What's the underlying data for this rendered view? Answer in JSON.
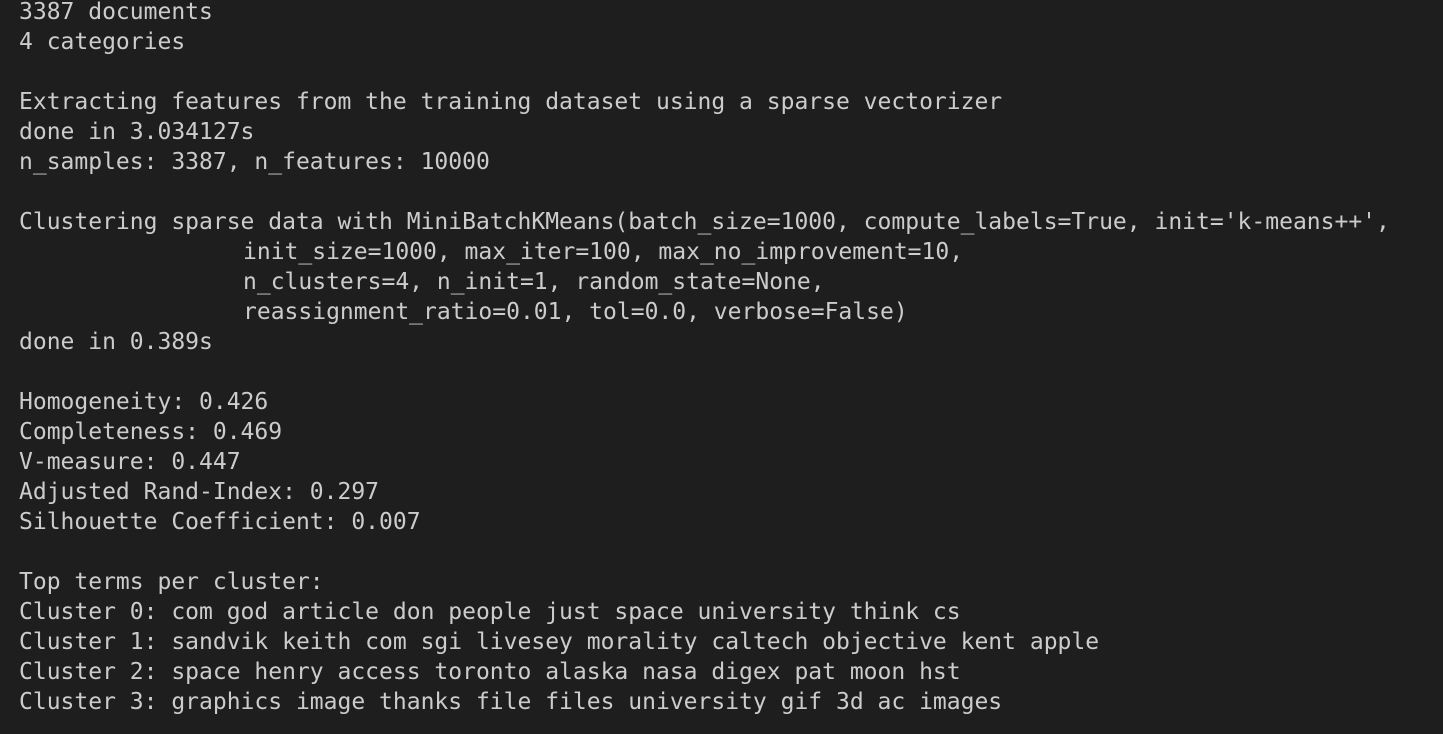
{
  "output": {
    "lines": [
      "3387 documents",
      "4 categories",
      "",
      "Extracting features from the training dataset using a sparse vectorizer",
      "done in 3.034127s",
      "n_samples: 3387, n_features: 10000",
      "",
      "Clustering sparse data with MiniBatchKMeans(batch_size=1000, compute_labels=True, init='k-means++',",
      "init_size=1000, max_iter=100, max_no_improvement=10,",
      "n_clusters=4, n_init=1, random_state=None,",
      "reassignment_ratio=0.01, tol=0.0, verbose=False)",
      "done in 0.389s",
      "",
      "Homogeneity: 0.426",
      "Completeness: 0.469",
      "V-measure: 0.447",
      "Adjusted Rand-Index: 0.297",
      "Silhouette Coefficient: 0.007",
      "",
      "Top terms per cluster:",
      "Cluster 0: com god article don people just space university think cs",
      "Cluster 1: sandvik keith com sgi livesey morality caltech objective kent apple",
      "Cluster 2: space henry access toronto alaska nasa digex pat moon hst",
      "Cluster 3: graphics image thanks file files university gif 3d ac images"
    ]
  }
}
